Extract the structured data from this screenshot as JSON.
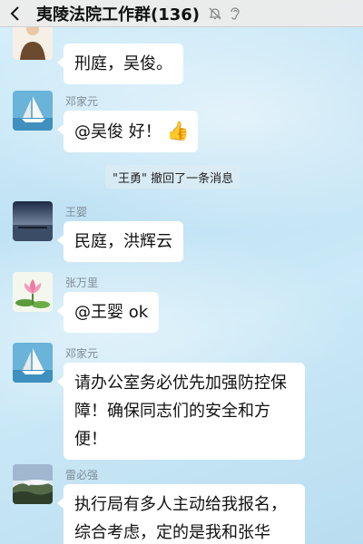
{
  "header": {
    "title": "夷陵法院工作群(136)",
    "back_icon": "chevron-left-icon",
    "mute_icon": "bell-off-icon",
    "ear_icon": "ear-icon"
  },
  "messages": [
    {
      "sender": "",
      "text": "刑庭，吴俊。",
      "avatar": "avatar-person"
    },
    {
      "sender": "邓家元",
      "text": "@吴俊 好！",
      "emoji": "👍",
      "avatar": "avatar-sailboat"
    },
    {
      "sender": "王婴",
      "text": "民庭，洪辉云",
      "avatar": "avatar-pier"
    },
    {
      "sender": "张万里",
      "text": "@王婴 ok",
      "avatar": "avatar-lotus"
    },
    {
      "sender": "邓家元",
      "lines": [
        "请办公室务必优先加强防控保",
        "障！确保同志们的安全和方",
        "便！"
      ],
      "avatar": "avatar-sailboat"
    },
    {
      "sender": "雷必强",
      "lines": [
        "执行局有多人主动给我报名，",
        "综合考虑，定的是我和张华"
      ],
      "avatar": "avatar-mountain"
    }
  ],
  "system_notice": "\"王勇\" 撤回了一条消息",
  "colors": {
    "bubble": "#ffffff",
    "background": "#c6e6f6",
    "header": "#ebebeb"
  }
}
